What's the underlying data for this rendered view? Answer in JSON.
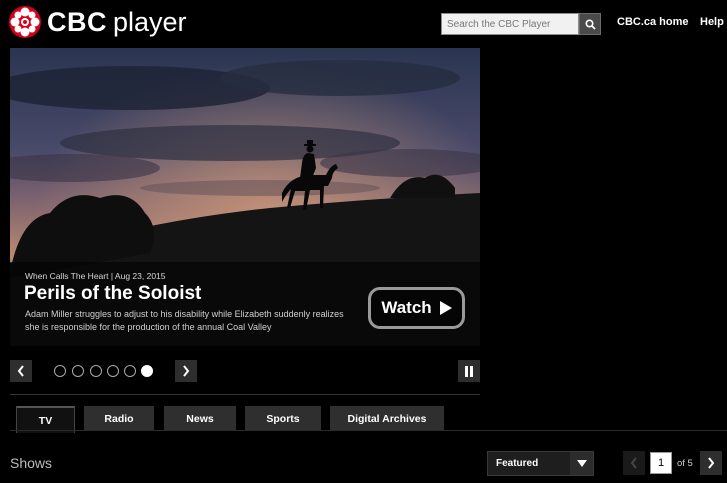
{
  "header": {
    "brand": "CBC",
    "product": "player",
    "search_placeholder": "Search the CBC Player",
    "links": [
      "CBC.ca home",
      "Help"
    ]
  },
  "hero": {
    "meta": "When Calls The Heart | Aug 23, 2015",
    "title": "Perils of the Soloist",
    "description": "Adam Miller struggles to adjust to his disability while Elizabeth suddenly realizes she is responsible for the production of the annual Coal Valley",
    "watch_label": "Watch"
  },
  "carousel": {
    "total_slides": 6,
    "active_slide": 6
  },
  "tabs": [
    "TV",
    "Radio",
    "News",
    "Sports",
    "Digital Archives"
  ],
  "active_tab": "TV",
  "shows": {
    "title": "Shows",
    "sort_selected": "Featured",
    "page_current": "1",
    "page_of": "of 5"
  },
  "colors": {
    "brand_red": "#d6001c",
    "background": "#000000",
    "tab_bg": "#2f2f2f"
  }
}
